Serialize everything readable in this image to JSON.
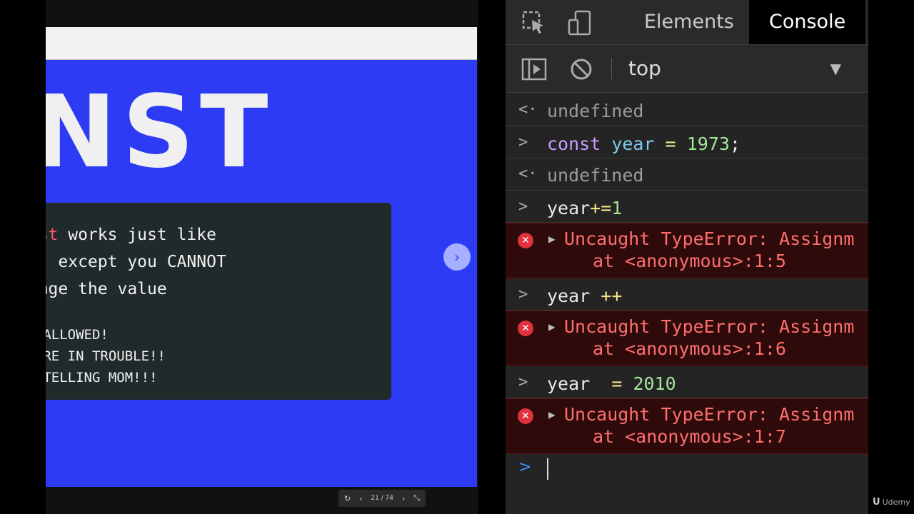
{
  "slide": {
    "heading": "NST",
    "explain_keyword": "onst",
    "explain_line1_rest": " works just like",
    "explain_line2": "et, except you CANNOT",
    "explain_line3": "hange the value",
    "shout_1": "OT ALLOWED!",
    "shout_2": "OU'RE IN TROUBLE!!",
    "shout_3": "'M TELLING MOM!!!",
    "counter": "21 / 74",
    "next_glyph": "›",
    "colors": {
      "background": "#2d3bf5",
      "panel": "#202a2a",
      "keyword": "#ff5a6e"
    }
  },
  "devtools": {
    "tabs": {
      "elements": "Elements",
      "console": "Console"
    },
    "context": "top",
    "entries": [
      {
        "kind": "result",
        "glyph": "<·",
        "text": "undefined"
      },
      {
        "kind": "input",
        "glyph": ">",
        "keyword": "const",
        "variable": "year",
        "operator": "=",
        "number": "1973",
        "tail": ";"
      },
      {
        "kind": "result",
        "glyph": "<·",
        "text": "undefined"
      },
      {
        "kind": "input",
        "glyph": ">",
        "variable": "year",
        "operator": "+=",
        "number": "1"
      },
      {
        "kind": "error",
        "line1": "Uncaught TypeError: Assignm",
        "line2": "at <anonymous>:1:5"
      },
      {
        "kind": "input",
        "glyph": ">",
        "variable": "year ",
        "operator": "++"
      },
      {
        "kind": "error",
        "line1": "Uncaught TypeError: Assignm",
        "line2": "at <anonymous>:1:6"
      },
      {
        "kind": "input",
        "glyph": ">",
        "variable": "year  ",
        "operator": "=",
        "number": "2010"
      },
      {
        "kind": "error",
        "line1": "Uncaught TypeError: Assignm",
        "line2": "at <anonymous>:1:7"
      }
    ],
    "prompt_glyph": ">"
  },
  "watermark": {
    "mark": "U",
    "name": "Udemy"
  },
  "icons": [
    "inspect-element-icon",
    "device-toolbar-icon",
    "sidebar-toggle-icon",
    "clear-console-icon",
    "dropdown-arrow-icon",
    "error-icon",
    "expand-triangle-icon",
    "reload-icon",
    "prev-icon",
    "next-icon",
    "fullscreen-icon"
  ]
}
